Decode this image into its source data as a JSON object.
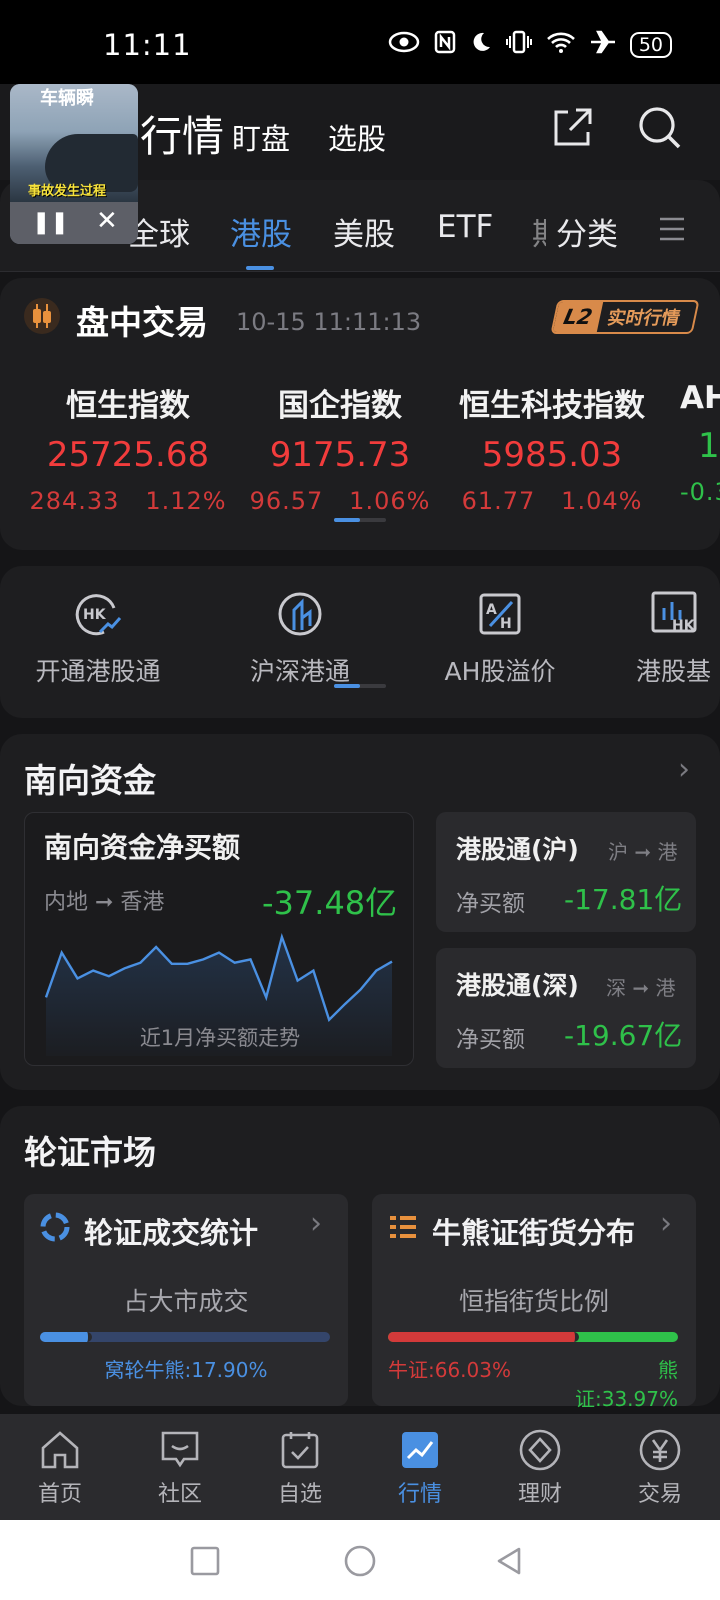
{
  "status_bar": {
    "time": "11:11",
    "battery": "50"
  },
  "pip": {
    "top_text": "车辆瞬",
    "caption": "事故发生过程"
  },
  "header": {
    "title": "行情",
    "tabs": [
      "盯盘",
      "选股"
    ]
  },
  "market_tabs": {
    "items": [
      "全球",
      "港股",
      "美股",
      "ETF",
      "期"
    ],
    "active": "港股",
    "more_label": "分类"
  },
  "trading": {
    "title": "盘中交易",
    "time": "10-15 11:11:13",
    "badge_l2": "L2",
    "badge_text": "实时行情",
    "indices": [
      {
        "name": "恒生指数",
        "value": "25725.68",
        "change": "284.33",
        "pct": "1.12%"
      },
      {
        "name": "国企指数",
        "value": "9175.73",
        "change": "96.57",
        "pct": "1.06%"
      },
      {
        "name": "恒生科技指数",
        "value": "5985.03",
        "change": "61.77",
        "pct": "1.04%"
      },
      {
        "name": "AH",
        "value": "1",
        "change": "-0.3",
        "pct": ""
      }
    ]
  },
  "quick_entries": [
    "开通港股通",
    "沪深港通",
    "AH股溢价",
    "港股基"
  ],
  "southbound": {
    "title": "南向资金",
    "net_buy_title": "南向资金净买额",
    "direction": "内地 ➞ 香港",
    "net_buy_value": "-37.48亿",
    "chart_note": "近1月净买额走势",
    "trend": [
      0.38,
      0.78,
      0.55,
      0.62,
      0.57,
      0.64,
      0.69,
      0.83,
      0.68,
      0.68,
      0.72,
      0.78,
      0.69,
      0.72,
      0.38,
      0.92,
      0.53,
      0.62,
      0.18,
      0.32,
      0.45,
      0.62,
      0.7
    ],
    "sh_connect": {
      "title": "港股通(沪)",
      "tag": "沪 ➞ 港",
      "label": "净买额",
      "value": "-17.81亿"
    },
    "sz_connect": {
      "title": "港股通(深)",
      "tag": "深 ➞ 港",
      "label": "净买额",
      "value": "-19.67亿"
    }
  },
  "warrants": {
    "title": "轮证市场",
    "stats": {
      "title": "轮证成交统计",
      "subtitle": "占大市成交",
      "footer": "窝轮牛熊:17.90%",
      "fraction": 0.179
    },
    "cbbc": {
      "title": "牛熊证街货分布",
      "subtitle": "恒指街货比例",
      "bull": "牛证:66.03%",
      "bear": "熊证:33.97%",
      "bull_fraction": 0.6603
    }
  },
  "bottom_nav": {
    "items": [
      "首页",
      "社区",
      "自选",
      "行情",
      "理财",
      "交易"
    ],
    "active": "行情"
  },
  "colors": {
    "accent": "#4a90e2",
    "up": "#f23c3c",
    "down": "#2fc14a",
    "badge": "#d88a4a"
  }
}
